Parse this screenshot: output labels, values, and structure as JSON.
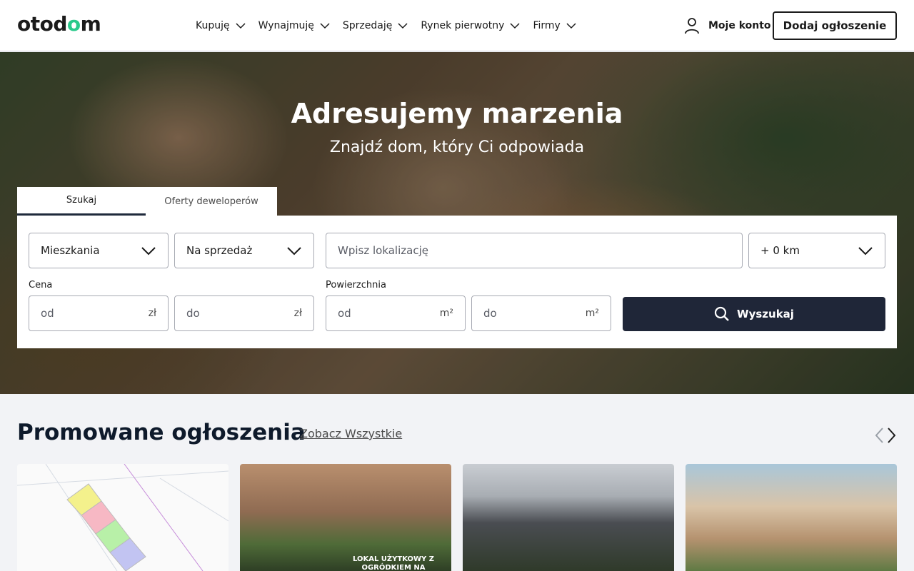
{
  "header": {
    "logo": {
      "text_prefix": "otod",
      "text_accent": "o",
      "text_suffix": "m",
      "accent_color": "#29c98b"
    },
    "nav": [
      {
        "label": "Kupuję"
      },
      {
        "label": "Wynajmuję"
      },
      {
        "label": "Sprzedaję"
      },
      {
        "label": "Rynek pierwotny"
      },
      {
        "label": "Firmy"
      }
    ],
    "account_label": "Moje konto",
    "add_button": "Dodaj ogłoszenie"
  },
  "hero": {
    "title": "Adresujemy marzenia",
    "subtitle": "Znajdź dom, który Ci odpowiada"
  },
  "search": {
    "tabs": [
      {
        "label": "Szukaj",
        "active": true
      },
      {
        "label": "Oferty deweloperów",
        "active": false
      }
    ],
    "property_type": "Mieszkania",
    "transaction": "Na sprzedaż",
    "location_placeholder": "Wpisz lokalizację",
    "distance": "+ 0 km",
    "price_label": "Cena",
    "price_from_placeholder": "od",
    "price_to_placeholder": "do",
    "price_unit": "zł",
    "area_label": "Powierzchnia",
    "area_from_placeholder": "od",
    "area_to_placeholder": "do",
    "area_unit": "m²",
    "submit": "Wyszukaj",
    "button_color": "#1f2638"
  },
  "promoted": {
    "title": "Promowane ogłoszenia",
    "see_all": "Zobacz Wszystkie",
    "card2_badge": "LOKAL UŻYTKOWY Z OGRÓDKIEM NA"
  }
}
